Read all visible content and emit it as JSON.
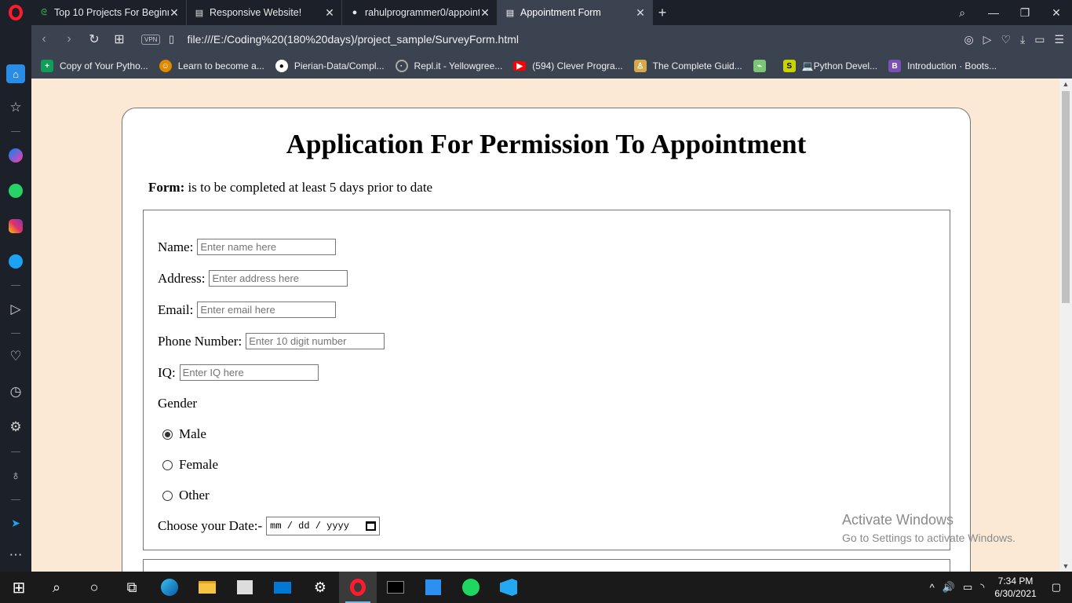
{
  "tabs": [
    {
      "title": "Top 10 Projects For Beginn",
      "icon": "geeksforgeeks-icon",
      "active": false
    },
    {
      "title": "Responsive Website!",
      "icon": "page-icon",
      "active": false
    },
    {
      "title": "rahulprogrammer0/appoint",
      "icon": "github-icon",
      "active": false
    },
    {
      "title": "Appointment Form",
      "icon": "page-icon",
      "active": true
    }
  ],
  "address": {
    "vpn": "VPN",
    "url": "file:///E:/Coding%20(180%20days)/project_sample/SurveyForm.html"
  },
  "bookmarks": [
    {
      "label": "Copy of Your Pytho...",
      "icon": "sheets-icon",
      "color": "#0f9d58"
    },
    {
      "label": "Learn to become a...",
      "icon": "avatar-icon",
      "color": "#e08a00"
    },
    {
      "label": "Pierian-Data/Compl...",
      "icon": "github-icon",
      "color": "#ffffff"
    },
    {
      "label": "Repl.it - Yellowgree...",
      "icon": "replit-icon",
      "color": "#aaaaaa"
    },
    {
      "label": "(594) Clever Progra...",
      "icon": "youtube-icon",
      "color": "#ff0000"
    },
    {
      "label": "The Complete Guid...",
      "icon": "person-icon",
      "color": "#d4a84b"
    },
    {
      "label": "",
      "icon": "image-icon",
      "color": "#7cc576"
    },
    {
      "label": "💻Python Devel...",
      "icon": "snake-icon",
      "color": "#c8d400"
    },
    {
      "label": "Introduction · Boots...",
      "icon": "bootstrap-icon",
      "color": "#7952b3"
    }
  ],
  "page": {
    "heading": "Application For Permission To Appointment",
    "intro_label": "Form:",
    "intro_text": " is to be completed at least 5 days prior to date",
    "fields": {
      "name_label": "Name:",
      "name_placeholder": "Enter name here",
      "address_label": "Address:",
      "address_placeholder": "Enter address here",
      "email_label": "Email:",
      "email_placeholder": "Enter email here",
      "phone_label": "Phone Number:",
      "phone_placeholder": "Enter 10 digit number",
      "iq_label": "IQ:",
      "iq_placeholder": "Enter IQ here"
    },
    "gender": {
      "label": "Gender",
      "options": [
        "Male",
        "Female",
        "Other"
      ],
      "selected": "Male"
    },
    "date": {
      "label": "Choose your Date:-",
      "placeholder": "mm / dd / yyyy"
    }
  },
  "watermark": {
    "line1": "Activate Windows",
    "line2": "Go to Settings to activate Windows."
  },
  "taskbar": {
    "time": "7:34 PM",
    "date": "6/30/2021"
  }
}
